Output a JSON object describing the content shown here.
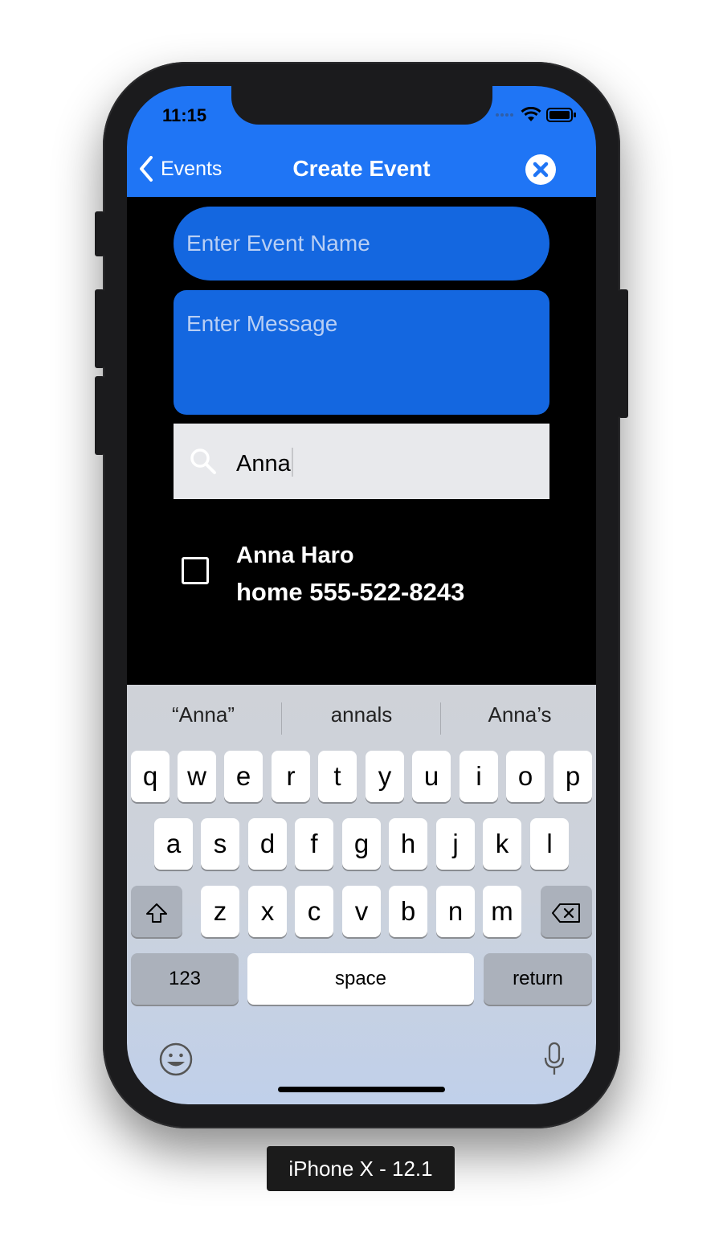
{
  "status_bar": {
    "time": "11:15"
  },
  "navbar": {
    "back_label": "Events",
    "title": "Create Event"
  },
  "form": {
    "event_name_placeholder": "Enter Event Name",
    "message_placeholder": "Enter Message"
  },
  "search": {
    "value": "Anna"
  },
  "contacts": [
    {
      "name": "Anna Haro",
      "phone": "home 555-522-8243",
      "checked": false
    }
  ],
  "keyboard": {
    "suggestions": [
      "“Anna”",
      "annals",
      "Anna’s"
    ],
    "row1": [
      "q",
      "w",
      "e",
      "r",
      "t",
      "y",
      "u",
      "i",
      "o",
      "p"
    ],
    "row2": [
      "a",
      "s",
      "d",
      "f",
      "g",
      "h",
      "j",
      "k",
      "l"
    ],
    "row3": [
      "z",
      "x",
      "c",
      "v",
      "b",
      "n",
      "m"
    ],
    "numbers_label": "123",
    "space_label": "space",
    "return_label": "return"
  },
  "device_label": "iPhone X - 12.1",
  "colors": {
    "accent": "#1f75f5",
    "field": "#1467e0",
    "background": "#000000"
  }
}
